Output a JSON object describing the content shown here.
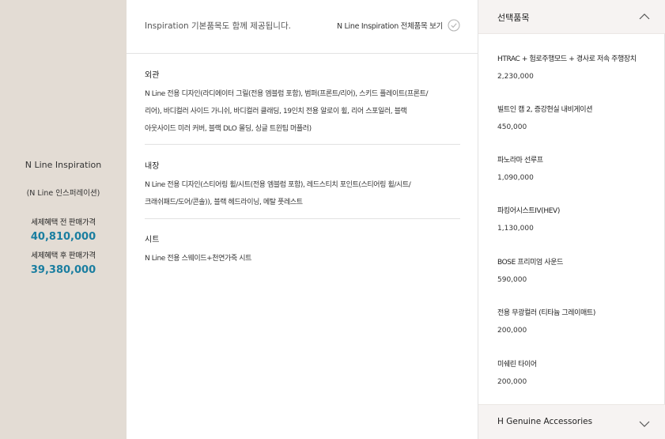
{
  "trim": {
    "name": "N Line Inspiration",
    "sub_name": "(N Line 인스퍼레이션)",
    "price_before_label": "세제혜택 전 판매가격",
    "price_before": "40,810,000",
    "price_after_label": "세제혜택 후 판매가격",
    "price_after": "39,380,000"
  },
  "basic": {
    "intro": "Inspiration 기본품목도 함께 제공됩니다.",
    "view_all_label": "N Line Inspiration 전체품목 보기",
    "sections": [
      {
        "title": "외관",
        "lines": [
          "N Line 전용 디자인(라디에이터 그릴(전용 엠블럼 포함), 범퍼(프론트/리어), 스키드 플레이트(프론트/",
          "리어), 바디컬러 사이드 가니쉬, 바디컬러 클래딩, 19인치 전용 알로이 휠, 리어 스포일러, 블랙",
          "아웃사이드 미러 커버, 블랙 DLO 몰딩, 싱글 트윈팁 머플러)"
        ]
      },
      {
        "title": "내장",
        "lines": [
          "N Line 전용 디자인(스티어링 휠/시트(전용 엠블럼 포함), 레드스티치 포인트(스티어링 휠/시트/",
          "크래쉬패드/도어/콘솔)), 블랙 헤드라이닝, 메탈 풋레스트"
        ]
      },
      {
        "title": "시트",
        "lines": [
          "N Line 전용 스웨이드+천연가죽 시트"
        ]
      }
    ]
  },
  "selected": {
    "header_label": "선택품목",
    "options": [
      {
        "name": "HTRAC + 험로주행모드 + 경사로 저속 주행장치",
        "price": "2,230,000"
      },
      {
        "name": "빌트인 캠 2, 증강현실 내비게이션",
        "price": "450,000"
      },
      {
        "name": "파노라마 선루프",
        "price": "1,090,000"
      },
      {
        "name": "파킹어시스트IV(HEV)",
        "price": "1,130,000"
      },
      {
        "name": "BOSE 프리미엄 사운드",
        "price": "590,000"
      },
      {
        "name": "전용 무광컬러 (티타늄 그레이매트)",
        "price": "200,000"
      },
      {
        "name": "미쉐린 타이어",
        "price": "200,000"
      }
    ],
    "footer_label": "H Genuine Accessories"
  },
  "colors": {
    "left_bg": "#e3dcd4",
    "price_accent": "#1a7ea0",
    "panel_head_bg": "#f6f3f2",
    "divider": "#e2e2e2"
  },
  "icons": {
    "view_all": "check-circle-icon",
    "selected_toggle": "chevron-up-icon",
    "accessories_toggle": "chevron-down-icon"
  }
}
